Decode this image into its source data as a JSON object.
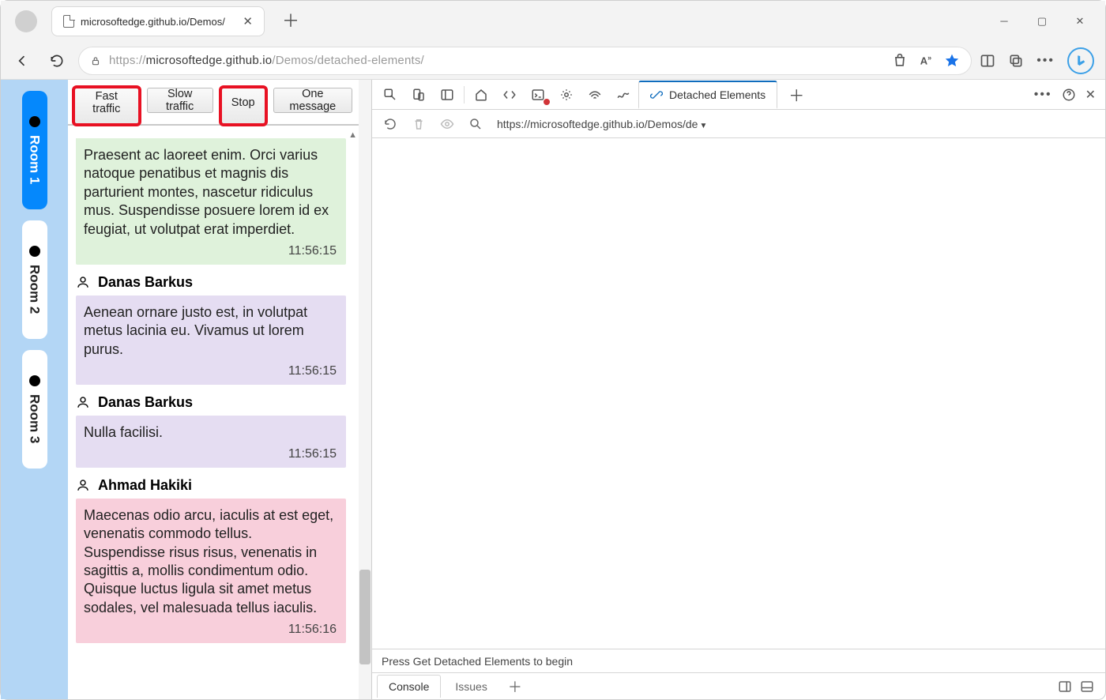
{
  "browser": {
    "tab_title": "microsoftedge.github.io/Demos/",
    "url_scheme": "https://",
    "url_host": "microsoftedge.github.io",
    "url_path": "/Demos/detached-elements/"
  },
  "rooms": [
    {
      "label": "Room 1",
      "active": true
    },
    {
      "label": "Room 2",
      "active": false
    },
    {
      "label": "Room 3",
      "active": false
    }
  ],
  "buttons": {
    "fast": "Fast traffic",
    "slow": "Slow traffic",
    "stop": "Stop",
    "one": "One message"
  },
  "messages": [
    {
      "author": null,
      "color": "green",
      "text": "Praesent ac laoreet enim. Orci varius natoque penatibus et magnis dis parturient montes, nascetur ridiculus mus. Suspendisse posuere lorem id ex feugiat, ut volutpat erat imperdiet.",
      "time": "11:56:15"
    },
    {
      "author": "Danas Barkus",
      "color": "purple",
      "text": "Aenean ornare justo est, in volutpat metus lacinia eu. Vivamus ut lorem purus.",
      "time": "11:56:15"
    },
    {
      "author": "Danas Barkus",
      "color": "purple",
      "text": "Nulla facilisi.",
      "time": "11:56:15"
    },
    {
      "author": "Ahmad Hakiki",
      "color": "pink",
      "text": "Maecenas odio arcu, iaculis at est eget, venenatis commodo tellus. Suspendisse risus risus, venenatis in sagittis a, mollis condimentum odio. Quisque luctus ligula sit amet metus sodales, vel malesuada tellus iaculis.",
      "time": "11:56:16"
    }
  ],
  "devtools": {
    "active_tab": "Detached Elements",
    "toolbar_url": "https://microsoftedge.github.io/Demos/de",
    "status_text": "Press Get Detached Elements to begin",
    "drawer_console": "Console",
    "drawer_issues": "Issues"
  }
}
